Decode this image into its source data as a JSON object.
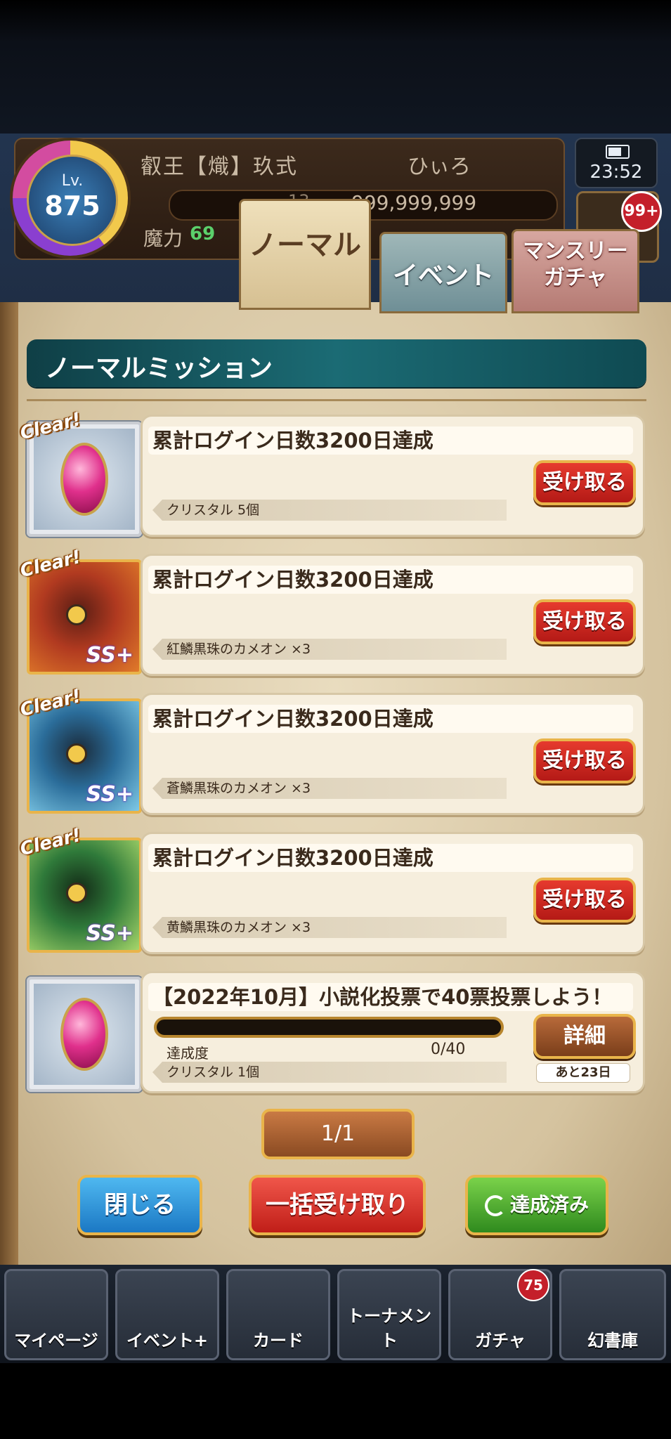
{
  "status_bar": {
    "level_label": "Lv.",
    "level": "875",
    "player_title": "叡王【熾】玖式",
    "player_name": "ひぃろ",
    "coins": "999,999,999",
    "small_count": "13",
    "magic_label": "魔力",
    "magic_value": "69",
    "clock": "23:52",
    "notification_badge": "99+"
  },
  "tabs": [
    {
      "label": "ノーマル",
      "active": true
    },
    {
      "label": "イベント",
      "active": false
    },
    {
      "label": "マンスリー\nガチャ",
      "active": false
    }
  ],
  "section_title": "ノーマルミッション",
  "missions": [
    {
      "title": "累計ログイン日数3200日達成",
      "reward": "クリスタル 5個",
      "button": "受け取る",
      "icon": "crystal-icon",
      "clear_badge": "Clear!"
    },
    {
      "title": "累計ログイン日数3200日達成",
      "reward": "紅鱗黒珠のカメオン ×3",
      "button": "受け取る",
      "icon": "red-chameleon-icon",
      "clear_badge": "Clear!"
    },
    {
      "title": "累計ログイン日数3200日達成",
      "reward": "蒼鱗黒珠のカメオン ×3",
      "button": "受け取る",
      "icon": "blue-chameleon-icon",
      "clear_badge": "Clear!"
    },
    {
      "title": "累計ログイン日数3200日達成",
      "reward": "黄鱗黒珠のカメオン ×3",
      "button": "受け取る",
      "icon": "green-chameleon-icon",
      "clear_badge": "Clear!"
    },
    {
      "title": "【2022年10月】小説化投票で40票投票しよう！",
      "reward": "クリスタル 1個",
      "button": "詳細",
      "icon": "crystal-icon",
      "progress_label": "達成度",
      "progress_text": "0/40",
      "progress_fraction": 0,
      "remaining": "あと23日"
    }
  ],
  "pager": "1/1",
  "buttons": {
    "close": "閉じる",
    "claim_all": "一括受け取り",
    "completed": "達成済み"
  },
  "nav": [
    {
      "label": "マイページ"
    },
    {
      "label": "イベント+"
    },
    {
      "label": "カード"
    },
    {
      "label": "トーナメント"
    },
    {
      "label": "ガチャ"
    },
    {
      "label": "幻書庫"
    }
  ],
  "nav_badge": "75",
  "colors": {
    "section_teal": "#1b6b74",
    "claim_red": "#d32a22",
    "gold_border": "#e9b44a",
    "close_blue": "#1b78c4",
    "done_green": "#2f8a1e"
  }
}
